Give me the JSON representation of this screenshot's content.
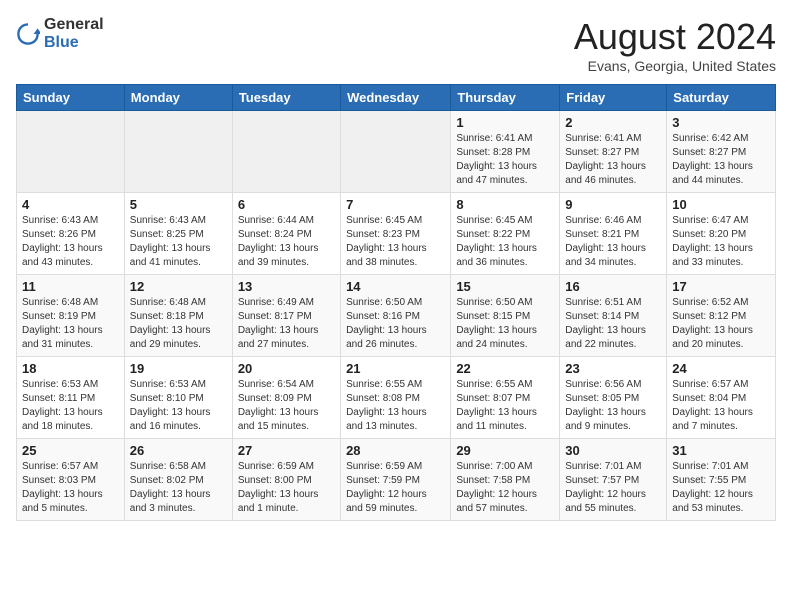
{
  "logo": {
    "general": "General",
    "blue": "Blue"
  },
  "header": {
    "month_year": "August 2024",
    "location": "Evans, Georgia, United States"
  },
  "days_of_week": [
    "Sunday",
    "Monday",
    "Tuesday",
    "Wednesday",
    "Thursday",
    "Friday",
    "Saturday"
  ],
  "weeks": [
    [
      {
        "day": "",
        "info": ""
      },
      {
        "day": "",
        "info": ""
      },
      {
        "day": "",
        "info": ""
      },
      {
        "day": "",
        "info": ""
      },
      {
        "day": "1",
        "info": "Sunrise: 6:41 AM\nSunset: 8:28 PM\nDaylight: 13 hours and 47 minutes."
      },
      {
        "day": "2",
        "info": "Sunrise: 6:41 AM\nSunset: 8:27 PM\nDaylight: 13 hours and 46 minutes."
      },
      {
        "day": "3",
        "info": "Sunrise: 6:42 AM\nSunset: 8:27 PM\nDaylight: 13 hours and 44 minutes."
      }
    ],
    [
      {
        "day": "4",
        "info": "Sunrise: 6:43 AM\nSunset: 8:26 PM\nDaylight: 13 hours and 43 minutes."
      },
      {
        "day": "5",
        "info": "Sunrise: 6:43 AM\nSunset: 8:25 PM\nDaylight: 13 hours and 41 minutes."
      },
      {
        "day": "6",
        "info": "Sunrise: 6:44 AM\nSunset: 8:24 PM\nDaylight: 13 hours and 39 minutes."
      },
      {
        "day": "7",
        "info": "Sunrise: 6:45 AM\nSunset: 8:23 PM\nDaylight: 13 hours and 38 minutes."
      },
      {
        "day": "8",
        "info": "Sunrise: 6:45 AM\nSunset: 8:22 PM\nDaylight: 13 hours and 36 minutes."
      },
      {
        "day": "9",
        "info": "Sunrise: 6:46 AM\nSunset: 8:21 PM\nDaylight: 13 hours and 34 minutes."
      },
      {
        "day": "10",
        "info": "Sunrise: 6:47 AM\nSunset: 8:20 PM\nDaylight: 13 hours and 33 minutes."
      }
    ],
    [
      {
        "day": "11",
        "info": "Sunrise: 6:48 AM\nSunset: 8:19 PM\nDaylight: 13 hours and 31 minutes."
      },
      {
        "day": "12",
        "info": "Sunrise: 6:48 AM\nSunset: 8:18 PM\nDaylight: 13 hours and 29 minutes."
      },
      {
        "day": "13",
        "info": "Sunrise: 6:49 AM\nSunset: 8:17 PM\nDaylight: 13 hours and 27 minutes."
      },
      {
        "day": "14",
        "info": "Sunrise: 6:50 AM\nSunset: 8:16 PM\nDaylight: 13 hours and 26 minutes."
      },
      {
        "day": "15",
        "info": "Sunrise: 6:50 AM\nSunset: 8:15 PM\nDaylight: 13 hours and 24 minutes."
      },
      {
        "day": "16",
        "info": "Sunrise: 6:51 AM\nSunset: 8:14 PM\nDaylight: 13 hours and 22 minutes."
      },
      {
        "day": "17",
        "info": "Sunrise: 6:52 AM\nSunset: 8:12 PM\nDaylight: 13 hours and 20 minutes."
      }
    ],
    [
      {
        "day": "18",
        "info": "Sunrise: 6:53 AM\nSunset: 8:11 PM\nDaylight: 13 hours and 18 minutes."
      },
      {
        "day": "19",
        "info": "Sunrise: 6:53 AM\nSunset: 8:10 PM\nDaylight: 13 hours and 16 minutes."
      },
      {
        "day": "20",
        "info": "Sunrise: 6:54 AM\nSunset: 8:09 PM\nDaylight: 13 hours and 15 minutes."
      },
      {
        "day": "21",
        "info": "Sunrise: 6:55 AM\nSunset: 8:08 PM\nDaylight: 13 hours and 13 minutes."
      },
      {
        "day": "22",
        "info": "Sunrise: 6:55 AM\nSunset: 8:07 PM\nDaylight: 13 hours and 11 minutes."
      },
      {
        "day": "23",
        "info": "Sunrise: 6:56 AM\nSunset: 8:05 PM\nDaylight: 13 hours and 9 minutes."
      },
      {
        "day": "24",
        "info": "Sunrise: 6:57 AM\nSunset: 8:04 PM\nDaylight: 13 hours and 7 minutes."
      }
    ],
    [
      {
        "day": "25",
        "info": "Sunrise: 6:57 AM\nSunset: 8:03 PM\nDaylight: 13 hours and 5 minutes."
      },
      {
        "day": "26",
        "info": "Sunrise: 6:58 AM\nSunset: 8:02 PM\nDaylight: 13 hours and 3 minutes."
      },
      {
        "day": "27",
        "info": "Sunrise: 6:59 AM\nSunset: 8:00 PM\nDaylight: 13 hours and 1 minute."
      },
      {
        "day": "28",
        "info": "Sunrise: 6:59 AM\nSunset: 7:59 PM\nDaylight: 12 hours and 59 minutes."
      },
      {
        "day": "29",
        "info": "Sunrise: 7:00 AM\nSunset: 7:58 PM\nDaylight: 12 hours and 57 minutes."
      },
      {
        "day": "30",
        "info": "Sunrise: 7:01 AM\nSunset: 7:57 PM\nDaylight: 12 hours and 55 minutes."
      },
      {
        "day": "31",
        "info": "Sunrise: 7:01 AM\nSunset: 7:55 PM\nDaylight: 12 hours and 53 minutes."
      }
    ]
  ]
}
